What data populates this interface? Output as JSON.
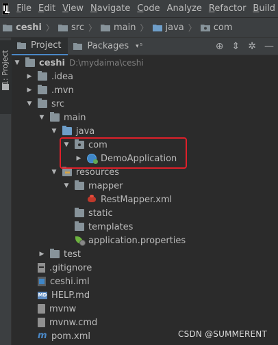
{
  "menubar": {
    "logo_text": "IJ",
    "items": [
      {
        "label": "File",
        "mnemonic": "F",
        "rest": "ile"
      },
      {
        "label": "Edit",
        "mnemonic": "E",
        "rest": "dit"
      },
      {
        "label": "View",
        "mnemonic": "V",
        "rest": "iew"
      },
      {
        "label": "Navigate",
        "mnemonic": "N",
        "rest": "avigate"
      },
      {
        "label": "Code",
        "mnemonic": "C",
        "rest": "ode"
      },
      {
        "label": "Analyze",
        "mnemonic": "",
        "rest": "Analyze"
      },
      {
        "label": "Refactor",
        "mnemonic": "R",
        "rest": "efactor"
      },
      {
        "label": "Build",
        "mnemonic": "B",
        "rest": "uild"
      }
    ]
  },
  "breadcrumb": [
    "ceshi",
    "src",
    "main",
    "java",
    "com"
  ],
  "side_tab_label": "1: Project",
  "toolbar": {
    "tab_project": "Project",
    "tab_packages": "Packages",
    "more_count": "▾ ⁵"
  },
  "tree": {
    "root_name": "ceshi",
    "root_path": "D:\\mydaima\\ceshi",
    "idea": ".idea",
    "mvn": ".mvn",
    "src": "src",
    "main": "main",
    "java": "java",
    "com": "com",
    "demo_app": "DemoApplication",
    "resources": "resources",
    "mapper": "mapper",
    "rest_mapper": "RestMapper.xml",
    "static": "static",
    "templates": "templates",
    "app_props": "application.properties",
    "test": "test",
    "gitignore": ".gitignore",
    "iml": "ceshi.iml",
    "help": "HELP.md",
    "mvnw": "mvnw",
    "mvnw_cmd": "mvnw.cmd",
    "pom": "pom.xml"
  },
  "watermark": "CSDN @SUMMERENT",
  "colors": {
    "highlight_box": "#e0202a",
    "selected_tab_underline": "#4a88c7"
  }
}
